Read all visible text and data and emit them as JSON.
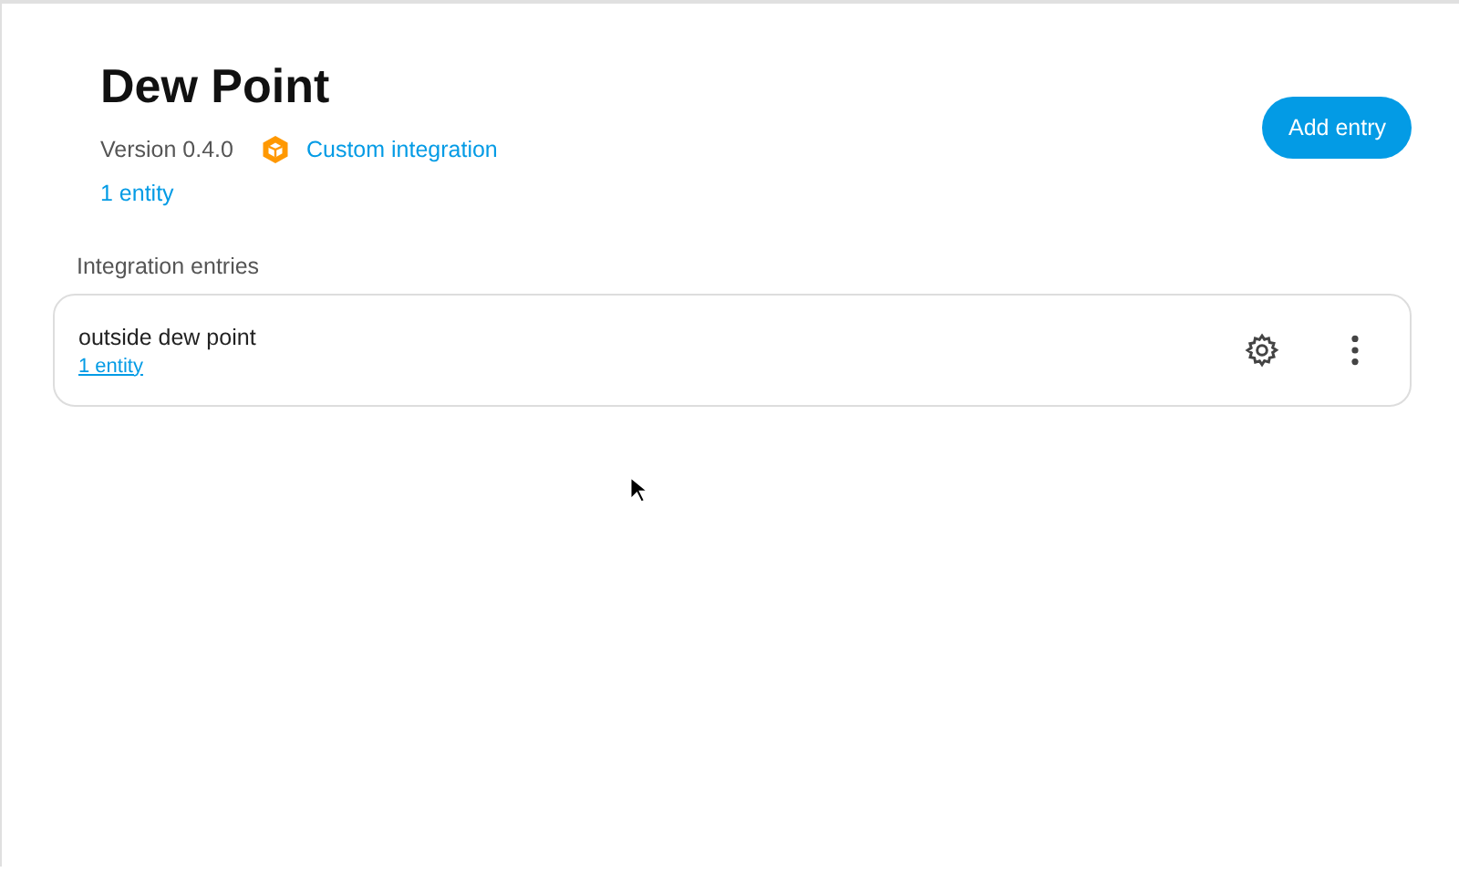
{
  "header": {
    "title": "Dew Point",
    "version": "Version 0.4.0",
    "custom_label": "Custom integration",
    "entity_link": "1 entity"
  },
  "add_button": "Add entry",
  "entries_section": {
    "title": "Integration entries",
    "entries": [
      {
        "name": "outside dew point",
        "entity_link": "1 entity"
      }
    ]
  }
}
